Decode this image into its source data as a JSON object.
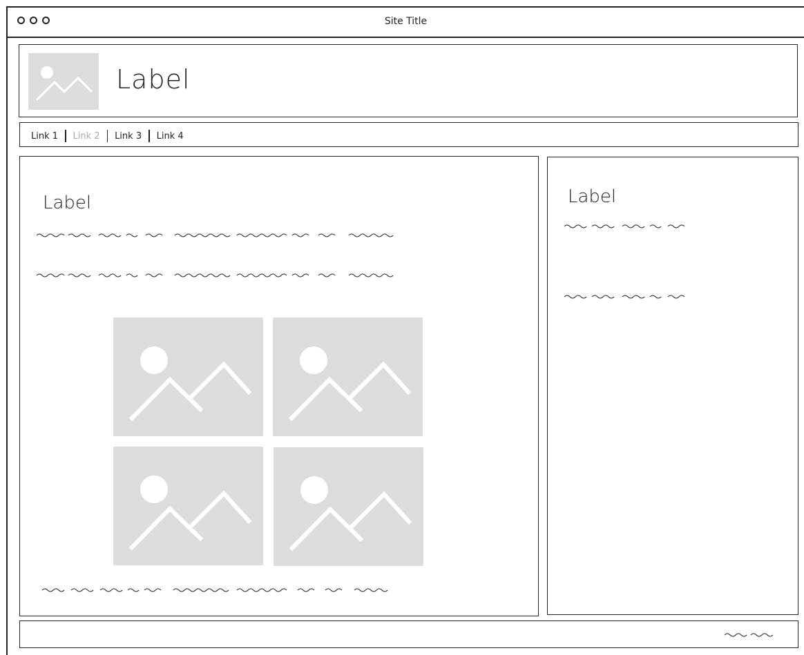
{
  "window": {
    "title": "Site Title"
  },
  "header": {
    "label": "Label",
    "logo_icon": "image-placeholder-icon"
  },
  "nav": {
    "links": [
      {
        "label": "Link 1",
        "active": false
      },
      {
        "label": "Link 2",
        "active": true
      },
      {
        "label": "Link 3",
        "active": false
      },
      {
        "label": "Link 4",
        "active": false
      }
    ]
  },
  "main": {
    "label": "Label",
    "gallery_icon": "image-placeholder-icon"
  },
  "sidebar": {
    "label": "Label"
  },
  "colors": {
    "stroke": "#222222",
    "placeholder": "#dcdcdc",
    "muted_link": "#aaaaaa"
  }
}
